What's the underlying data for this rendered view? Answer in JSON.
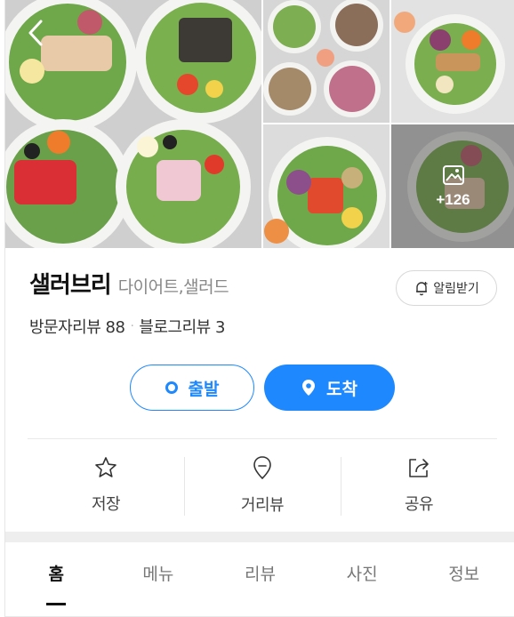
{
  "header": {
    "name": "샐러브리",
    "category": "다이어트,샐러드",
    "alert_label": "알림받기"
  },
  "photos": {
    "more_count": "+126"
  },
  "reviews": {
    "visitor_label": "방문자리뷰",
    "visitor_count": "88",
    "blog_label": "블로그리뷰",
    "blog_count": "3"
  },
  "route": {
    "depart_label": "출발",
    "arrive_label": "도착"
  },
  "actions": [
    {
      "label": "저장",
      "icon": "star-icon"
    },
    {
      "label": "거리뷰",
      "icon": "map-pin-outline-icon"
    },
    {
      "label": "공유",
      "icon": "share-icon"
    }
  ],
  "tabs": [
    {
      "label": "홈",
      "active": true
    },
    {
      "label": "메뉴",
      "active": false
    },
    {
      "label": "리뷰",
      "active": false
    },
    {
      "label": "사진",
      "active": false
    },
    {
      "label": "정보",
      "active": false
    }
  ],
  "colors": {
    "accent": "#1e88ff",
    "text": "#111111",
    "muted": "#888888"
  }
}
